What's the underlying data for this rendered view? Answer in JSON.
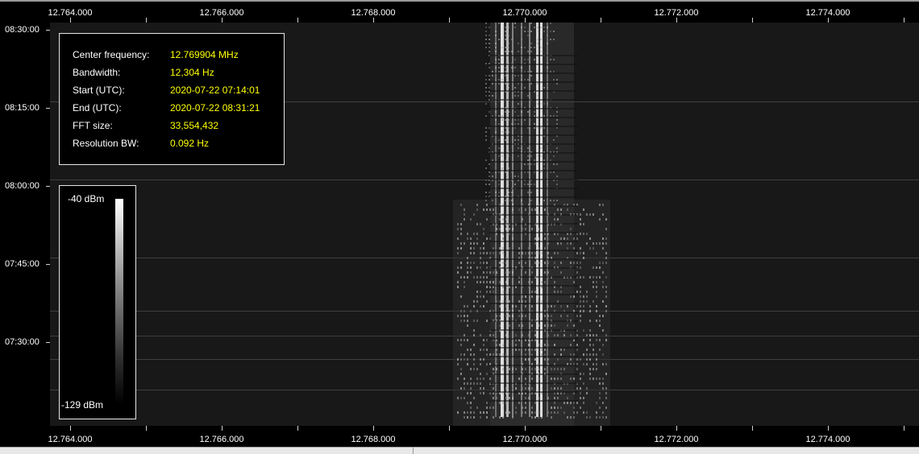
{
  "frequency_axis": {
    "unit_hint": "MHz",
    "labels": [
      "12.764.000",
      "12.766.000",
      "12.768.000",
      "12.770.000",
      "12.772.000",
      "12.774.000"
    ],
    "values_mhz": [
      12.764,
      12.766,
      12.768,
      12.77,
      12.772,
      12.774
    ]
  },
  "time_axis": {
    "labels": [
      "08:30:00",
      "08:15:00",
      "08:00:00",
      "07:45:00",
      "07:30:00"
    ]
  },
  "info": {
    "rows": [
      {
        "key": "Center frequency:",
        "value": "12.769904 MHz"
      },
      {
        "key": "Bandwidth:",
        "value": "12,304 Hz"
      },
      {
        "key": "Start (UTC):",
        "value": "2020-07-22 07:14:01"
      },
      {
        "key": "End (UTC):",
        "value": "2020-07-22 08:31:21"
      },
      {
        "key": "FFT size:",
        "value": "33,554,432"
      },
      {
        "key": "Resolution BW:",
        "value": "0.092 Hz"
      }
    ]
  },
  "legend": {
    "max_label": "-40 dBm",
    "min_label": "-129 dBm"
  },
  "colors": {
    "background": "#000000",
    "noise_floor": "#181818",
    "info_value": "#ffff00",
    "text": "#ffffff"
  }
}
